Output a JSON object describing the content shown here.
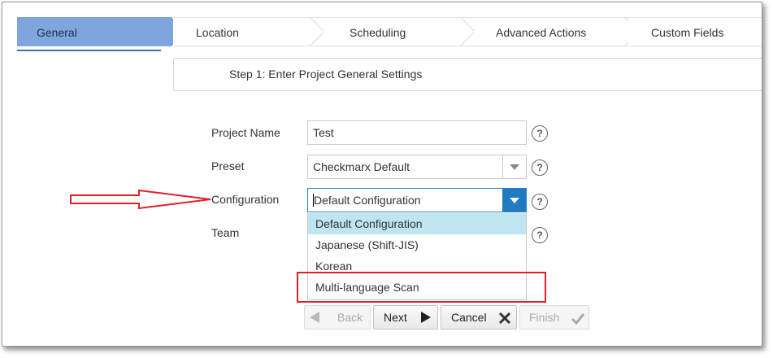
{
  "wizard": {
    "steps": [
      {
        "label": "General",
        "active": true
      },
      {
        "label": "Location",
        "active": false
      },
      {
        "label": "Scheduling",
        "active": false
      },
      {
        "label": "Advanced Actions",
        "active": false
      },
      {
        "label": "Custom Fields",
        "active": false
      }
    ]
  },
  "step_header": "Step 1: Enter Project General Settings",
  "form": {
    "project_name": {
      "label": "Project Name",
      "value": "Test"
    },
    "preset": {
      "label": "Preset",
      "value": "Checkmarx Default"
    },
    "configuration": {
      "label": "Configuration",
      "value": "Default Configuration"
    },
    "team": {
      "label": "Team"
    },
    "help_glyph": "?"
  },
  "configuration_options": [
    {
      "label": "Default Configuration",
      "selected": true
    },
    {
      "label": "Japanese (Shift-JIS)",
      "selected": false
    },
    {
      "label": "Korean",
      "selected": false
    },
    {
      "label": "Multi-language Scan",
      "selected": false
    }
  ],
  "buttons": {
    "back": "Back",
    "next": "Next",
    "cancel": "Cancel",
    "finish": "Finish"
  },
  "colors": {
    "active_step": "#7ea6dd",
    "accent_blue": "#1f7bc1",
    "option_highlight": "#bfe6f0",
    "annotation_red": "#e0202a"
  }
}
